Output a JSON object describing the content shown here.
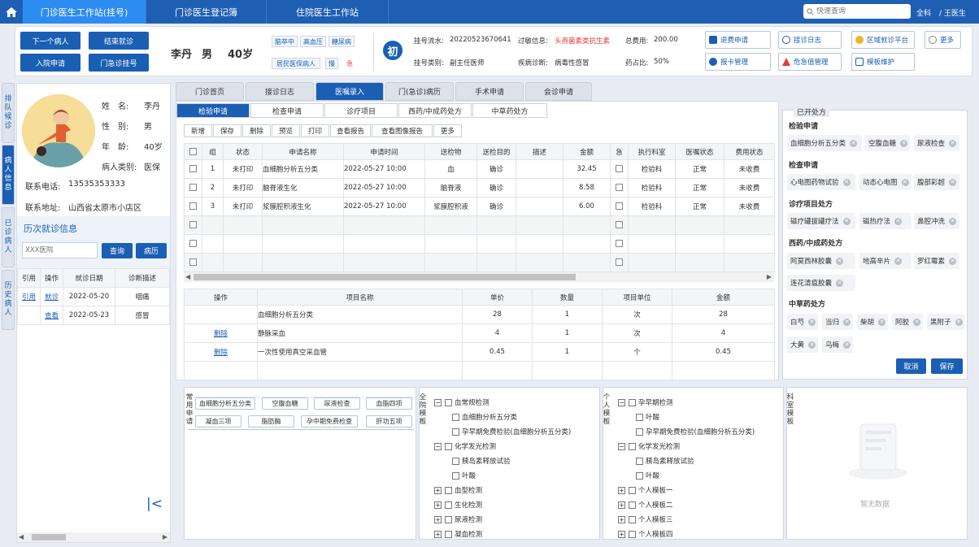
{
  "topbar": {
    "tabs": [
      "门诊医生工作站(挂号)",
      "门诊医生登记簿",
      "住院医生工作站"
    ],
    "search_placeholder": "快速查询",
    "user_label": "全科",
    "doctor": "/ 王医生"
  },
  "header": {
    "buttons": [
      "下一个病人",
      "结束就诊",
      "入院申请",
      "门急诊挂号"
    ],
    "patient_name": "李丹",
    "patient_sex": "男",
    "patient_age": "40岁",
    "tags": [
      "脑卒中",
      "高血压",
      "糖尿病",
      "居民医保病人",
      "慢",
      "急"
    ],
    "visit_badge": "初",
    "serial_label": "挂号流水:",
    "serial": "20220523670641",
    "allergy_label": "过敏信息:",
    "allergy": "头孢菌素类抗生素",
    "total_label": "总费用:",
    "total": "200.00",
    "regtype_label": "挂号类别:",
    "regtype": "副主任医师",
    "diagnosis_label": "疾病诊断:",
    "diagnosis": "病毒性感冒",
    "drug_ratio_label": "药占比:",
    "drug_ratio": "50%",
    "actions": [
      "退费申请",
      "接诊日志",
      "区域就诊平台",
      "更多",
      "报卡管理",
      "危急值管理",
      "模板维护"
    ]
  },
  "sidetabs": [
    "排队候诊",
    "病人信息",
    "已诊病人",
    "历史病人"
  ],
  "patient": {
    "name_label": "姓　名:",
    "name": "李丹",
    "sex_label": "性　别:",
    "sex": "男",
    "age_label": "年　龄:",
    "age": "40岁",
    "type_label": "病人类别:",
    "type": "医保",
    "phone_label": "联系电话:",
    "phone": "13535353333",
    "addr_label": "联系地址:",
    "addr": "山西省太原市小店区",
    "history_title": "历次就诊信息",
    "hospital_placeholder": "XXX医院",
    "query_btn": "查询",
    "record_btn": "病历",
    "history_headers": [
      "引用",
      "操作",
      "就诊日期",
      "诊断描述"
    ],
    "history_rows": [
      {
        "ref": "引用",
        "op": "就诊",
        "date": "2022-05-20",
        "desc": "咽痛"
      },
      {
        "ref": "",
        "op": "查看",
        "date": "2022-05-23",
        "desc": "感冒"
      }
    ]
  },
  "main": {
    "tabs": [
      "门诊首页",
      "接诊日志",
      "医嘱录入",
      "门(急诊)病历",
      "手术申请",
      "会诊申请"
    ],
    "subtabs": [
      "检验申请",
      "检查申请",
      "诊疗项目",
      "西药/中成药处方",
      "中草药处方"
    ],
    "toolbar": [
      "新增",
      "保存",
      "删除",
      "预览",
      "打印",
      "查看报告",
      "查看图像报告",
      "更多"
    ],
    "order_headers": [
      "组",
      "状态",
      "申请名称",
      "申请时间",
      "送检物",
      "送检目的",
      "描述",
      "金额",
      "急",
      "执行科室",
      "医嘱状态",
      "费用状态"
    ],
    "orders": [
      {
        "group": "1",
        "status": "未打印",
        "name": "血细胞分析五分类",
        "time": "2022-05-27 10:00",
        "specimen": "血",
        "purpose": "确诊",
        "desc": "",
        "amount": "32.45",
        "dept": "检验科",
        "ostatus": "正常",
        "fstatus": "未收费"
      },
      {
        "group": "2",
        "status": "未打印",
        "name": "脑脊液生化",
        "time": "2022-05-27 10:00",
        "specimen": "脑脊液",
        "purpose": "确诊",
        "desc": "",
        "amount": "8.58",
        "dept": "检验科",
        "ostatus": "正常",
        "fstatus": "未收费"
      },
      {
        "group": "3",
        "status": "未打印",
        "name": "浆膜腔积液生化",
        "time": "2022-05-27 10:00",
        "specimen": "浆膜腔积液",
        "purpose": "确诊",
        "desc": "",
        "amount": "6.00",
        "dept": "检验科",
        "ostatus": "正常",
        "fstatus": "未收费"
      }
    ],
    "detail_headers": [
      "操作",
      "项目名称",
      "单价",
      "数量",
      "项目单位",
      "金额"
    ],
    "details": [
      {
        "op": "",
        "name": "血细胞分析五分类",
        "price": "28",
        "qty": "1",
        "unit": "次",
        "amount": "28"
      },
      {
        "op": "删除",
        "name": "静脉采血",
        "price": "4",
        "qty": "1",
        "unit": "次",
        "amount": "4"
      },
      {
        "op": "删除",
        "name": "一次性使用真空采血管",
        "price": "0.45",
        "qty": "1",
        "unit": "个",
        "amount": "0.45"
      }
    ]
  },
  "common": {
    "label": "常用申请",
    "chips": [
      "血细胞分析五分类",
      "空腹血糖",
      "尿液检查",
      "血脂四项",
      "凝血三项",
      "脂肪酶",
      "孕中期免费检查",
      "肝功五项"
    ]
  },
  "hospital_tpl": {
    "label": "全院模板",
    "tree": [
      {
        "level": 0,
        "text": "血常规检测",
        "type": "minus"
      },
      {
        "level": 1,
        "text": "血细胞分析五分类",
        "type": "leaf"
      },
      {
        "level": 1,
        "text": "孕早期免费检验(血细胞分析五分类)",
        "type": "leaf"
      },
      {
        "level": 0,
        "text": "化学发光检测",
        "type": "minus"
      },
      {
        "level": 1,
        "text": "胰岛素释放试验",
        "type": "leaf"
      },
      {
        "level": 1,
        "text": "叶酸",
        "type": "leaf"
      },
      {
        "level": 0,
        "text": "血型检测",
        "type": "plus"
      },
      {
        "level": 0,
        "text": "生化检测",
        "type": "plus"
      },
      {
        "level": 0,
        "text": "尿液检测",
        "type": "plus"
      },
      {
        "level": 0,
        "text": "凝血检测",
        "type": "plus"
      }
    ]
  },
  "personal_tpl": {
    "label": "个人模板",
    "tree": [
      {
        "level": 0,
        "text": "孕早期检测",
        "type": "minus"
      },
      {
        "level": 1,
        "text": "叶酸",
        "type": "leaf"
      },
      {
        "level": 1,
        "text": "孕早期免费检验(血细胞分析五分类)",
        "type": "leaf"
      },
      {
        "level": 0,
        "text": "化学发光检测",
        "type": "minus"
      },
      {
        "level": 1,
        "text": "胰岛素释放试验",
        "type": "leaf"
      },
      {
        "level": 1,
        "text": "叶酸",
        "type": "leaf"
      },
      {
        "level": 0,
        "text": "个人模板一",
        "type": "plus"
      },
      {
        "level": 0,
        "text": "个人模板二",
        "type": "plus"
      },
      {
        "level": 0,
        "text": "个人模板三",
        "type": "plus"
      },
      {
        "level": 0,
        "text": "个人模板四",
        "type": "plus"
      }
    ]
  },
  "dept_tpl": {
    "label": "科室模板",
    "empty": "暂无数据"
  },
  "rx": {
    "title": "已开处方",
    "sections": [
      {
        "title": "检验申请",
        "items": [
          "血细胞分析五分类",
          "空腹血糖",
          "尿液检查"
        ]
      },
      {
        "title": "检查申请",
        "items": [
          "心电图药物试验",
          "动态心电图",
          "腹部彩超"
        ]
      },
      {
        "title": "诊疗项目处方",
        "items": [
          "磁疗罐拔罐疗法",
          "磁热疗法",
          "鼻腔冲洗"
        ]
      },
      {
        "title": "西药/中成药处方",
        "items": [
          "阿莫西林胶囊",
          "地高辛片",
          "罗红霉素",
          "连花清瘟胶囊"
        ]
      },
      {
        "title": "中草药处方",
        "items": [
          "白芍",
          "当归",
          "柴胡",
          "阿胶",
          "黑附子",
          "大黄",
          "乌梅"
        ]
      }
    ],
    "cancel": "取消",
    "save": "保存"
  }
}
